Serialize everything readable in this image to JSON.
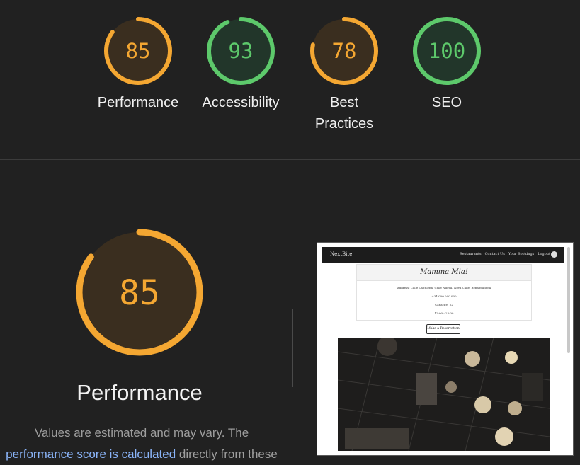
{
  "scores": [
    {
      "value": 85,
      "label": "Performance",
      "color": "#f4a732",
      "fill": "#3a2e1f"
    },
    {
      "value": 93,
      "label": "Accessibility",
      "color": "#5dc96b",
      "fill": "#22362a"
    },
    {
      "value": 78,
      "label": "Best Practices",
      "color": "#f4a732",
      "fill": "#3a2e1f"
    },
    {
      "value": 100,
      "label": "SEO",
      "color": "#5dc96b",
      "fill": "#22362a"
    }
  ],
  "main": {
    "score": 85,
    "title": "Performance",
    "desc_prefix": "Values are estimated and may vary. The",
    "desc_link": "performance score is calculated",
    "desc_suffix": "directly from these"
  },
  "screenshot": {
    "brand": "NextBite",
    "nav_links": [
      "Restaurants",
      "Contact Us",
      "Your Bookings",
      "Logout"
    ],
    "card_title": "Mamma Mia!",
    "address": "Address: Calle Cantilena, Calle Nueva, Nova Calle, Benalmádena",
    "phone": "+34 000 000 000",
    "capacity": "Capacity: 52",
    "hours": "12:00 - 23:00",
    "button": "Make a Reservation"
  }
}
